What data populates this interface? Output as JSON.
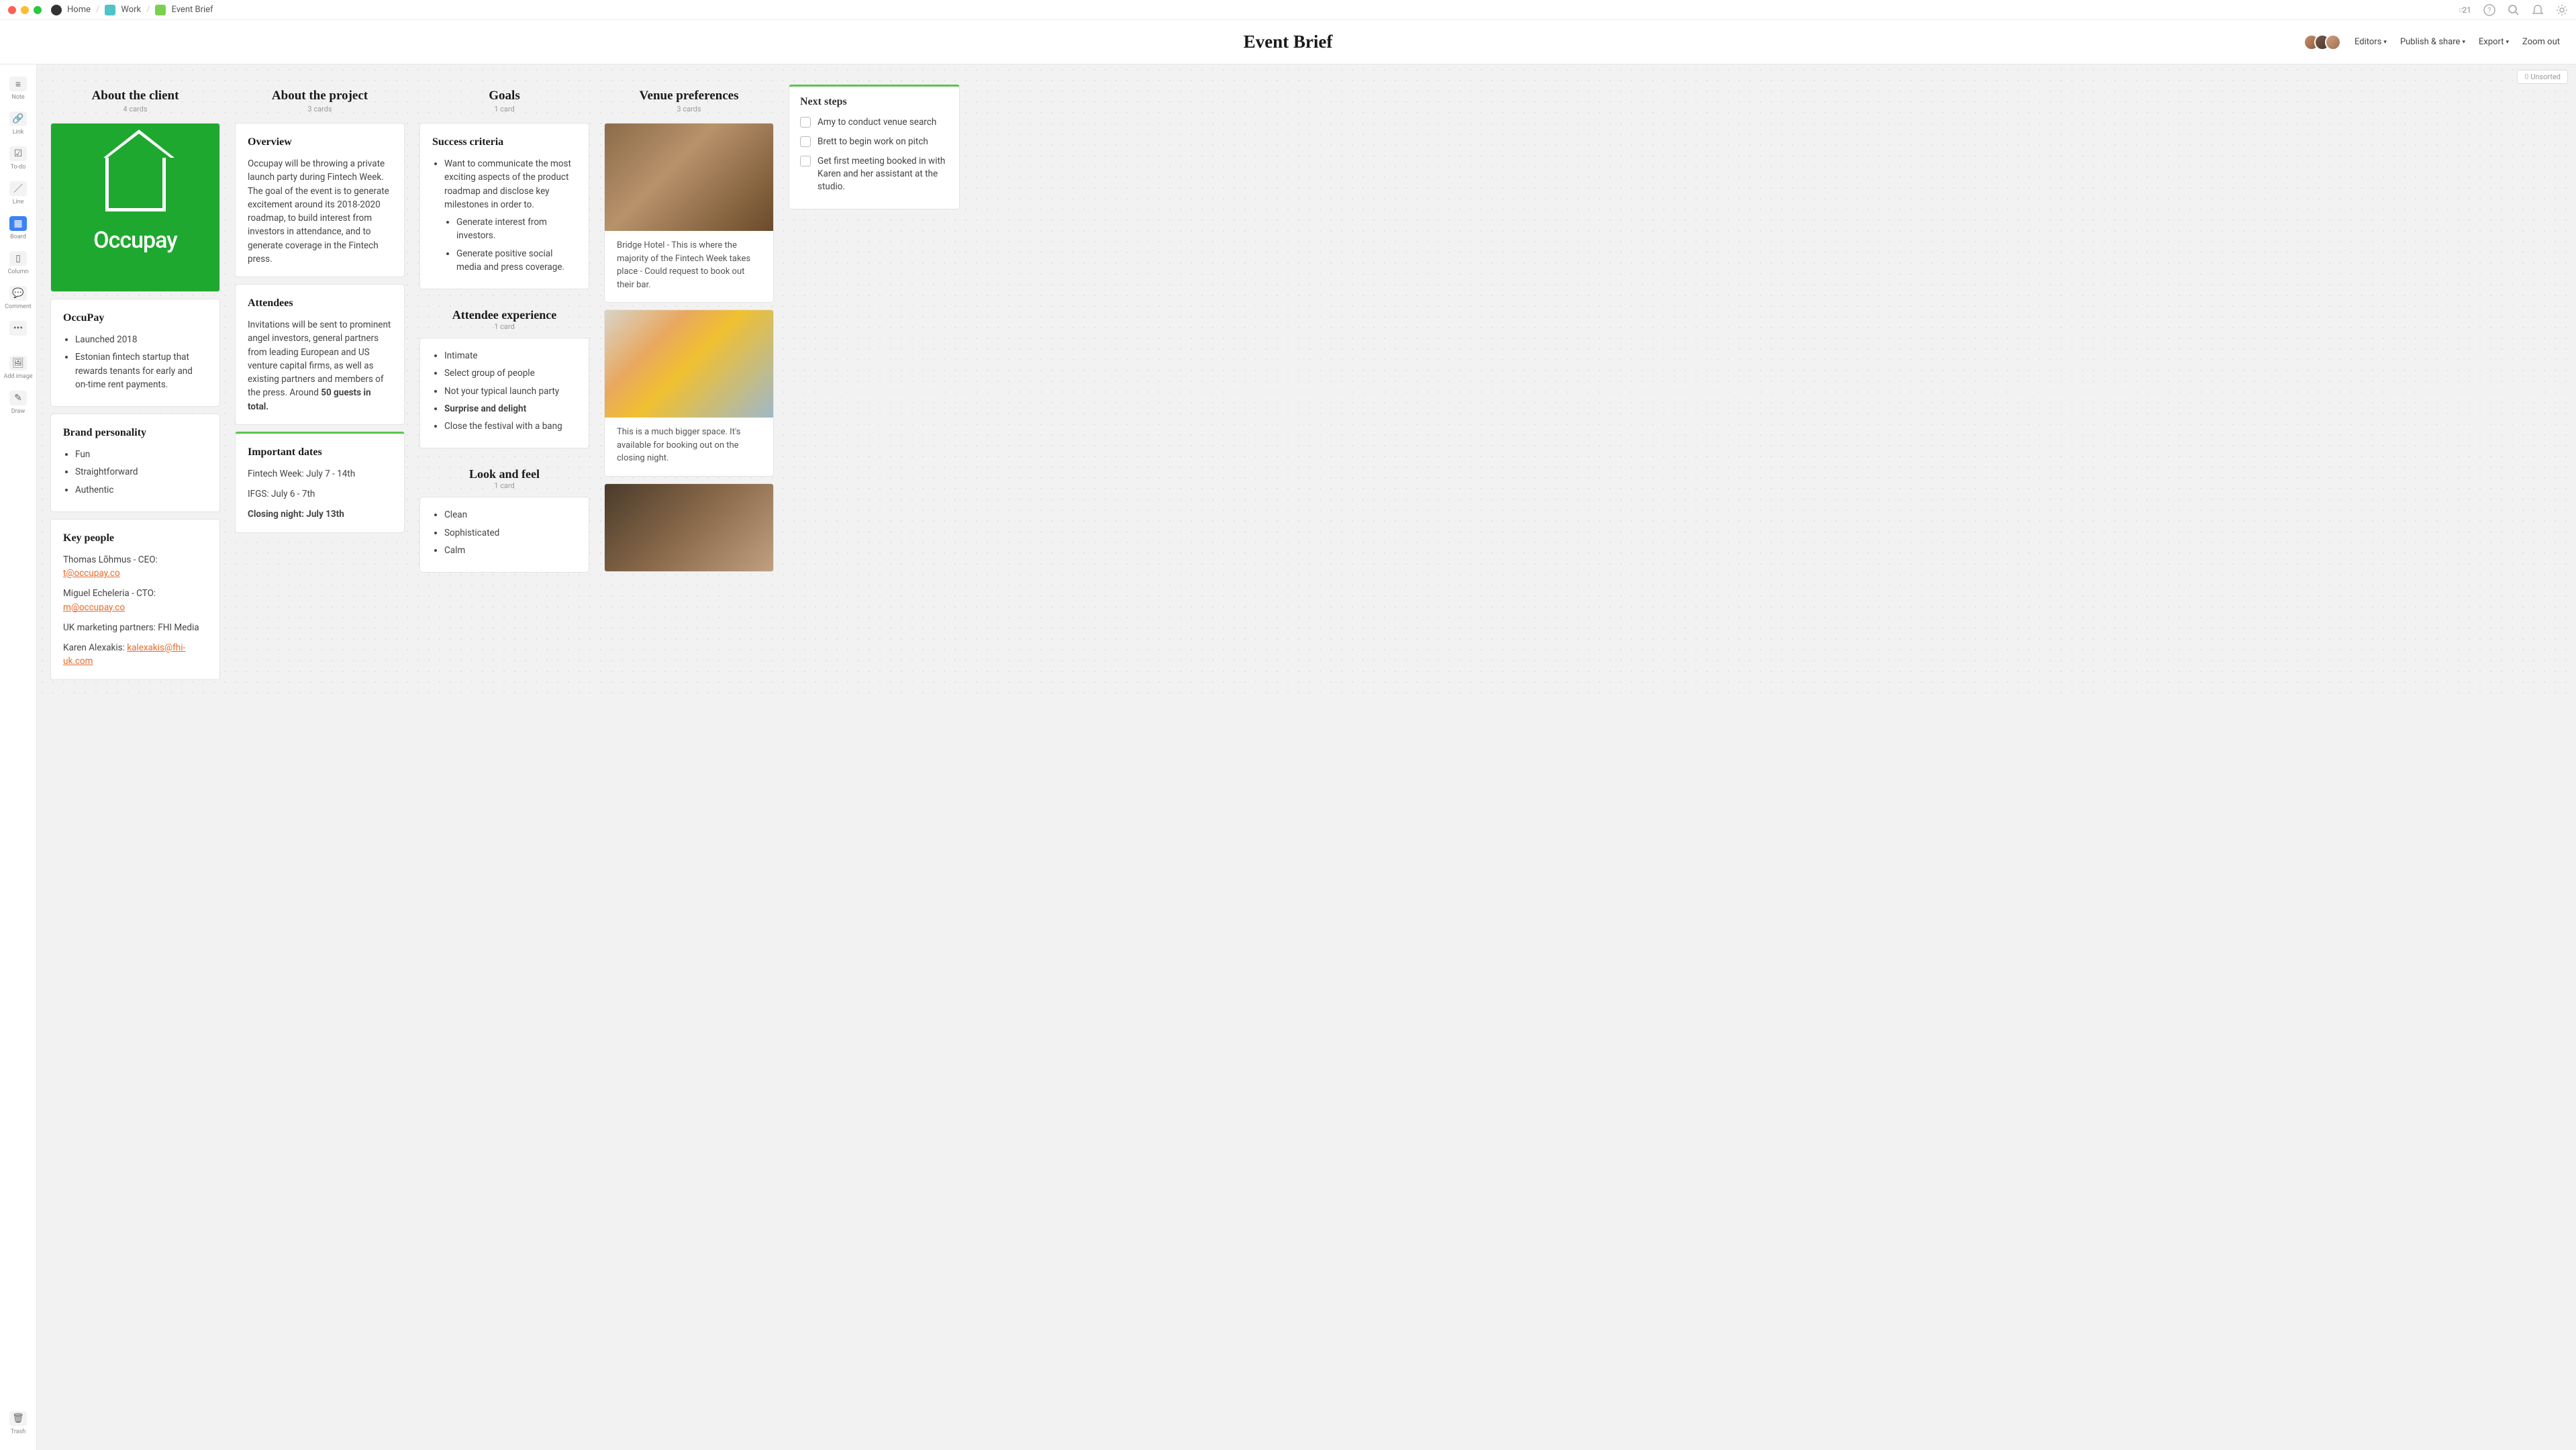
{
  "breadcrumbs": {
    "home": "Home",
    "work": "Work",
    "brief": "Event Brief"
  },
  "topbar": {
    "count": "21"
  },
  "header": {
    "title": "Event Brief",
    "editors": "Editors",
    "publish": "Publish & share",
    "export": "Export",
    "zoom": "Zoom out"
  },
  "toolbar": {
    "note": "Note",
    "link": "Link",
    "todo": "To-do",
    "line": "Line",
    "board": "Board",
    "column": "Column",
    "comment": "Comment",
    "addimage": "Add image",
    "draw": "Draw",
    "trash": "Trash"
  },
  "unsorted": {
    "count": "0",
    "label": "Unsorted"
  },
  "columns": {
    "about_client": {
      "title": "About the client",
      "meta": "4 cards"
    },
    "about_project": {
      "title": "About the project",
      "meta": "3 cards"
    },
    "goals": {
      "title": "Goals",
      "meta": "1 card"
    },
    "attendee_exp": {
      "title": "Attendee experience",
      "meta": "1 card"
    },
    "look_feel": {
      "title": "Look and feel",
      "meta": "1 card"
    },
    "venue": {
      "title": "Venue preferences",
      "meta": "3 cards"
    }
  },
  "cards": {
    "logo_text": "Occupay",
    "occupay": {
      "title": "OccuPay",
      "li1": "Launched 2018",
      "li2": "Estonian fintech startup that rewards tenants for early and on-time rent payments."
    },
    "brand": {
      "title": "Brand personality",
      "li1": "Fun",
      "li2": "Straightforward",
      "li3": "Authentic"
    },
    "people": {
      "title": "Key people",
      "p1a": "Thomas Lõhmus - CEO: ",
      "p1b": "t@occupay.co",
      "p2a": "Miguel Echeleria - CTO: ",
      "p2b": "m@occupay.co",
      "p3": "UK marketing partners: FHI Media",
      "p4a": "Karen Alexakis: ",
      "p4b": "kalexakis@fhi-uk.com"
    },
    "overview": {
      "title": "Overview",
      "body": "Occupay will be throwing a private launch party during Fintech Week. The goal of the event is to generate excitement around its 2018-2020 roadmap, to build interest from investors in attendance, and to generate coverage in the Fintech press."
    },
    "attendees": {
      "title": "Attendees",
      "body_a": "Invitations will be sent to prominent angel investors, general partners from leading European and US venture capital firms, as well as existing partners and members of the press. Around ",
      "body_b": "50 guests in total."
    },
    "dates": {
      "title": "Important dates",
      "p1": "Fintech Week: July 7 - 14th",
      "p2": "IFGS: July 6 - 7th",
      "p3": "Closing night: July 13th"
    },
    "success": {
      "title": "Success criteria",
      "li1": "Want to communicate the most exciting aspects of the product roadmap and disclose key milestones in order to.",
      "li1a": "Generate interest from investors.",
      "li1b": "Generate positive social media and press coverage."
    },
    "attexp": {
      "li1": "Intimate",
      "li2": "Select group of people",
      "li3": "Not your typical launch party",
      "li4": "Surprise and delight",
      "li5": "Close the festival with a bang"
    },
    "lookfeel": {
      "li1": "Clean",
      "li2": "Sophisticated",
      "li3": "Calm"
    },
    "venue1": "Bridge Hotel - This is where the majority of the Fintech Week takes place - Could request to book out their bar.",
    "venue2": "This is a much bigger space. It's available for booking out on the closing night."
  },
  "next_steps": {
    "title": "Next steps",
    "i1": "Amy to conduct venue search",
    "i2": "Brett to begin work on pitch",
    "i3": "Get first meeting booked in with Karen and her assistant at the studio."
  }
}
